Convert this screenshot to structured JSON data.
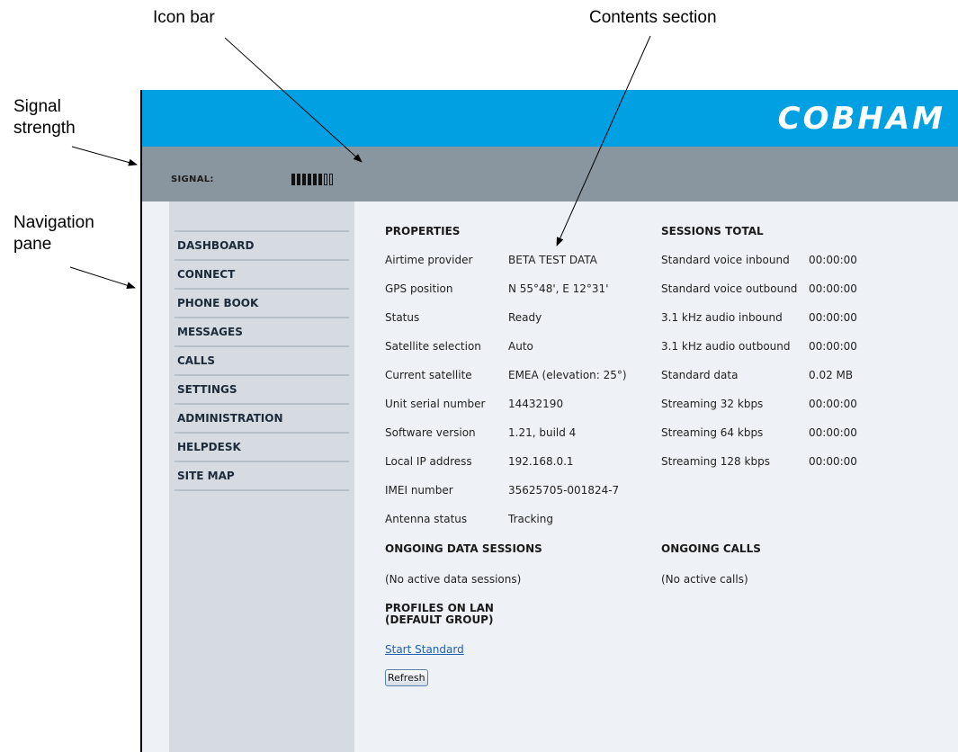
{
  "callouts": {
    "icon_bar": "Icon bar",
    "contents_section": "Contents section",
    "signal_strength": [
      "Signal",
      "strength"
    ],
    "navigation_pane": [
      "Navigation",
      "pane"
    ]
  },
  "header": {
    "logo": "COBHAM",
    "accent_color": "#00a0e3"
  },
  "icon_bar": {
    "signal_label": "SIGNAL:",
    "signal_segments_total": 8,
    "signal_segments_filled": 6
  },
  "nav": {
    "items": [
      {
        "label": "DASHBOARD"
      },
      {
        "label": "CONNECT"
      },
      {
        "label": "PHONE BOOK"
      },
      {
        "label": "MESSAGES"
      },
      {
        "label": "CALLS"
      },
      {
        "label": "SETTINGS"
      },
      {
        "label": "ADMINISTRATION"
      },
      {
        "label": "HELPDESK"
      },
      {
        "label": "SITE MAP"
      }
    ]
  },
  "properties": {
    "title": "PROPERTIES",
    "rows": [
      {
        "k": "Airtime provider",
        "v": "BETA TEST DATA"
      },
      {
        "k": "GPS position",
        "v": "N 55°48', E 12°31'"
      },
      {
        "k": "Status",
        "v": "Ready"
      },
      {
        "k": "Satellite selection",
        "v": "Auto"
      },
      {
        "k": "Current satellite",
        "v": "EMEA (elevation: 25°)"
      },
      {
        "k": "Unit serial number",
        "v": "14432190"
      },
      {
        "k": "Software version",
        "v": "1.21, build 4"
      },
      {
        "k": "Local IP address",
        "v": "192.168.0.1"
      },
      {
        "k": "IMEI number",
        "v": "35625705-001824-7"
      },
      {
        "k": "Antenna status",
        "v": "Tracking"
      }
    ]
  },
  "sessions_total": {
    "title": "SESSIONS TOTAL",
    "rows": [
      {
        "k": "Standard voice inbound",
        "v": "00:00:00"
      },
      {
        "k": "Standard voice outbound",
        "v": "00:00:00"
      },
      {
        "k": "3.1 kHz audio inbound",
        "v": "00:00:00"
      },
      {
        "k": "3.1 kHz audio outbound",
        "v": "00:00:00"
      },
      {
        "k": "Standard data",
        "v": "0.02 MB"
      },
      {
        "k": "Streaming 32 kbps",
        "v": "00:00:00"
      },
      {
        "k": "Streaming 64 kbps",
        "v": "00:00:00"
      },
      {
        "k": "Streaming 128 kbps",
        "v": "00:00:00"
      }
    ]
  },
  "ongoing_data": {
    "title": "ONGOING DATA SESSIONS",
    "text": "(No active data sessions)"
  },
  "ongoing_calls": {
    "title": "ONGOING CALLS",
    "text": "(No active calls)"
  },
  "profiles": {
    "title_line1": "PROFILES ON LAN",
    "title_line2": "(DEFAULT GROUP)",
    "link": "Start Standard"
  },
  "refresh_button": "Refresh"
}
